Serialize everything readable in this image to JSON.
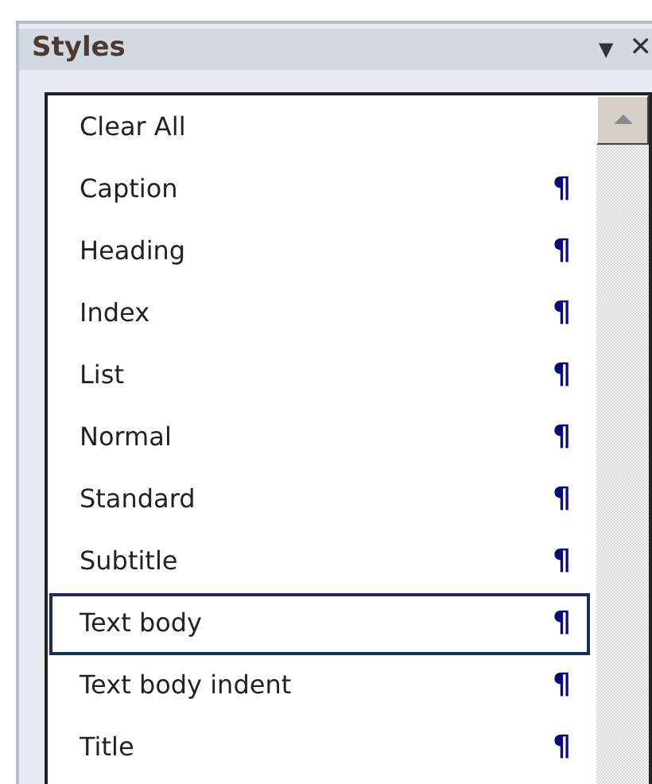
{
  "panel": {
    "title": "Styles",
    "menu_glyph": "▼",
    "close_glyph": "✕"
  },
  "styles": [
    {
      "name": "Clear All",
      "kind": "command",
      "selected": false
    },
    {
      "name": "Caption",
      "kind": "paragraph",
      "selected": false
    },
    {
      "name": "Heading",
      "kind": "paragraph",
      "selected": false
    },
    {
      "name": "Index",
      "kind": "paragraph",
      "selected": false
    },
    {
      "name": "List",
      "kind": "paragraph",
      "selected": false
    },
    {
      "name": "Normal",
      "kind": "paragraph",
      "selected": false
    },
    {
      "name": "Standard",
      "kind": "paragraph",
      "selected": false
    },
    {
      "name": "Subtitle",
      "kind": "paragraph",
      "selected": false
    },
    {
      "name": "Text body",
      "kind": "paragraph",
      "selected": true
    },
    {
      "name": "Text body indent",
      "kind": "paragraph",
      "selected": false
    },
    {
      "name": "Title",
      "kind": "paragraph",
      "selected": false
    }
  ],
  "pilcrow": "¶"
}
